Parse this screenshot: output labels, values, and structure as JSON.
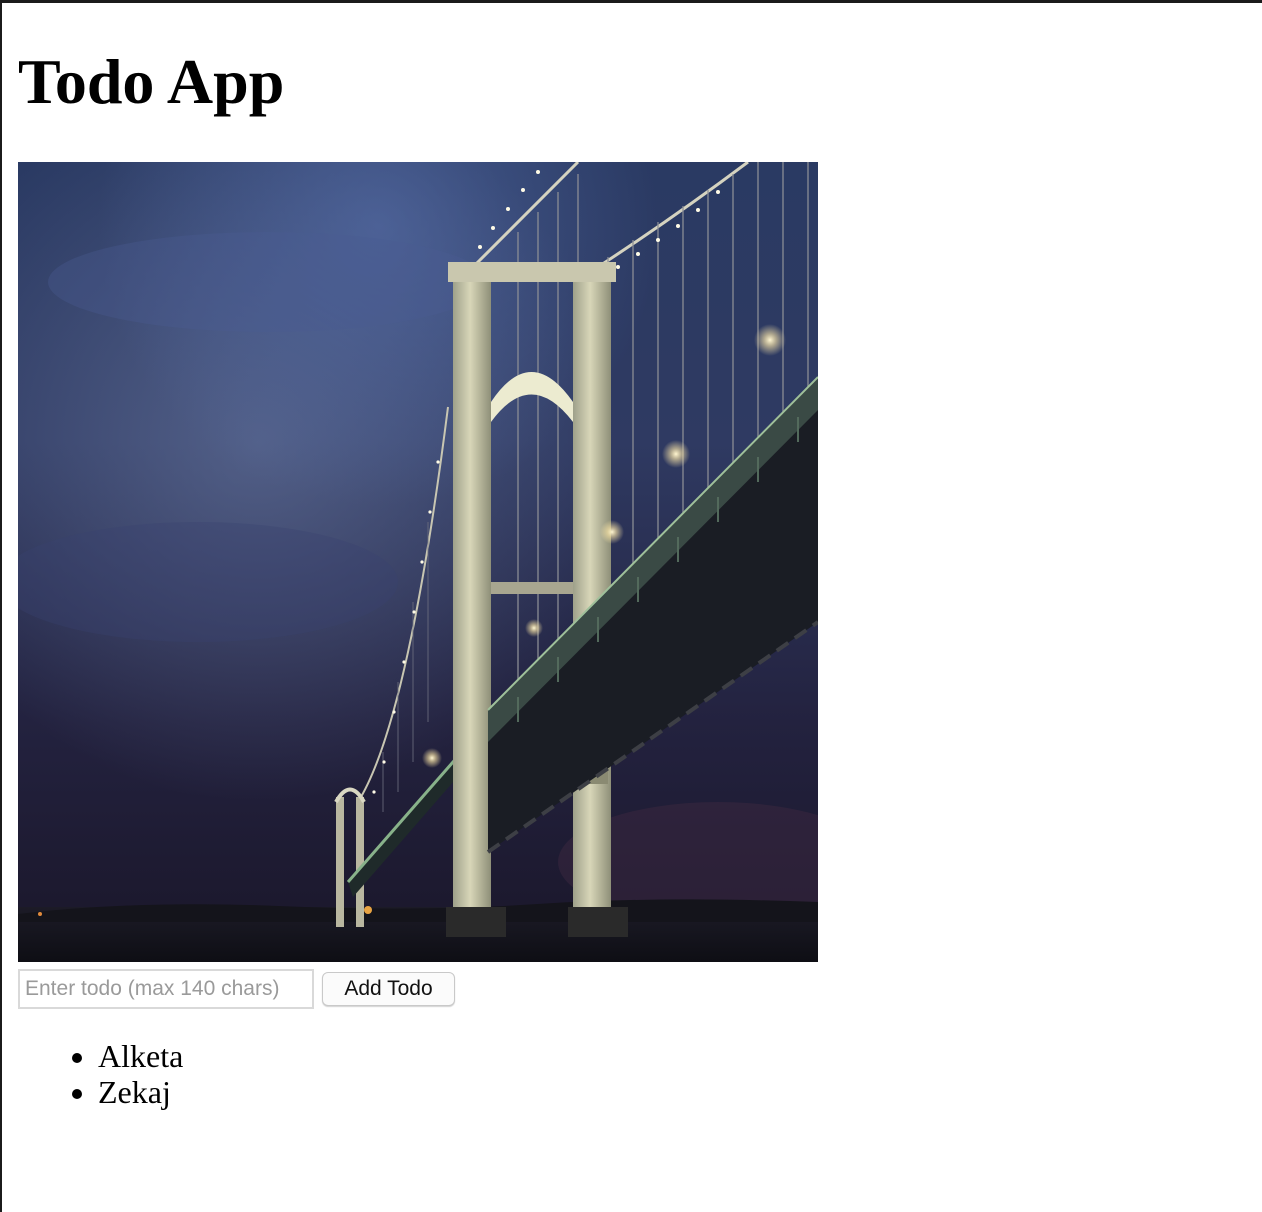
{
  "page": {
    "title": "Todo App"
  },
  "hero_image": {
    "description_icon": "suspension-bridge-night-photo"
  },
  "form": {
    "input_value": "",
    "input_placeholder": "Enter todo (max 140 chars)",
    "add_button_label": "Add Todo"
  },
  "todos": [
    {
      "label": "Alketa"
    },
    {
      "label": "Zekaj"
    }
  ],
  "colors": {
    "page_background": "#ffffff",
    "frame": "#1b1b1b",
    "placeholder": "#9a9a9a",
    "input_border": "#d9d9d9",
    "button_border": "#c9c9c9",
    "button_background": "#fbfbfb"
  }
}
